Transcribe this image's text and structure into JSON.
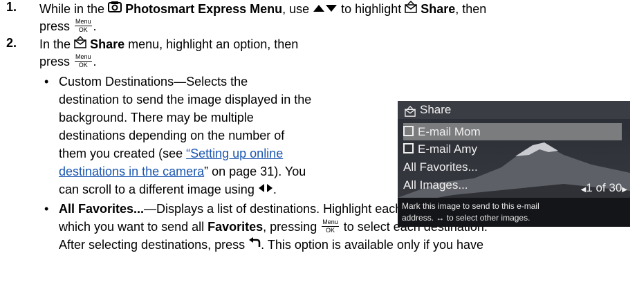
{
  "step1": {
    "num": "1.",
    "l1_a": "While in the ",
    "l1_bold": "Photosmart Express Menu",
    "l1_b": ", use ",
    "l1_c": " to highlight ",
    "l1_share": "Share",
    "l1_d": ", then",
    "l2_a": "press "
  },
  "step2": {
    "num": "2.",
    "l1_a": "In the ",
    "l1_share": "Share",
    "l1_b": " menu, highlight an option, then",
    "l2_a": "press "
  },
  "menu_ok": {
    "top": "Menu",
    "bottom": "OK"
  },
  "custom": {
    "bullet": "•",
    "lines": [
      "Custom Destinations—Selects the",
      "destination to send the image displayed in the",
      "background. There may be multiple",
      "destinations depending on the number of"
    ],
    "l5_a": "them you created (see ",
    "link_part1": "“Setting up online",
    "link_part2": "destinations in the camera",
    "l6_b": "” on page 31",
    "l6_c": "). You",
    "l7_a": "can scroll to a different image using "
  },
  "favorites": {
    "bullet": "•",
    "bold": "All Favorites...",
    "l1_rest": "—Displays a list of destinations. Highlight each destination to",
    "l2_a": "which you want to send all ",
    "l2_bold": "Favorites",
    "l2_b": ", pressing ",
    "l2_c": " to select each destination.",
    "l3_a": "After selecting destinations, press ",
    "l3_b": ". This option is available only if you have"
  },
  "screen": {
    "title": "Share",
    "options": [
      {
        "label": "E-mail Mom",
        "checkbox": true,
        "selected": true
      },
      {
        "label": "E-mail Amy",
        "checkbox": true,
        "selected": false
      },
      {
        "label": "All Favorites...",
        "checkbox": false,
        "selected": false
      },
      {
        "label": "All Images...",
        "checkbox": false,
        "selected": false
      }
    ],
    "counter": "1 of 30",
    "footer_line1": "Mark this image to send to this e-mail",
    "footer_line2": "address.  ↔ to select other images."
  },
  "icons": {
    "menu": "photosmart-menu-icon",
    "share": "share-icon",
    "updown": "up-down-arrows-icon",
    "leftright": "left-right-arrows-icon",
    "back": "back-arrow-icon"
  }
}
